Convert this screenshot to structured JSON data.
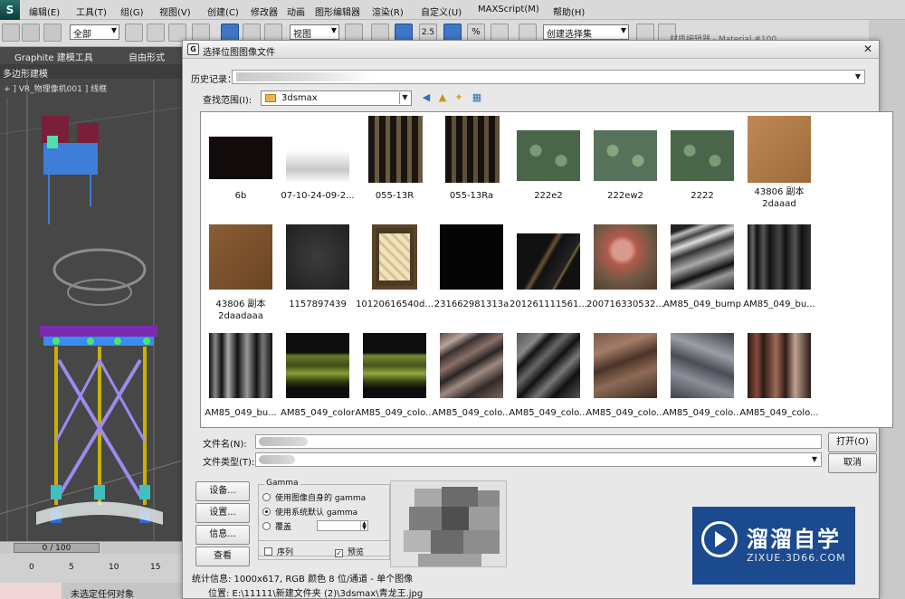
{
  "app": {
    "logo_text": "S",
    "menu": [
      "编辑(E)",
      "工具(T)",
      "组(G)",
      "视图(V)",
      "创建(C)",
      "修改器",
      "动画",
      "图形编辑器",
      "渲染(R)",
      "自定义(U)",
      "MAXScript(M)",
      "帮助(H)"
    ],
    "toolbar": {
      "filter_select": "全部",
      "view_select": "视图",
      "selection_set": "创建选择集",
      "snap_2_5": "2.5",
      "percent_snap": "%"
    },
    "ribbon": {
      "tabs": [
        "Graphite 建模工具",
        "自由形式"
      ],
      "subtab": "多边形建模"
    },
    "viewport_label": "+ ] VR_物理像机001 ] 线框",
    "timeline": "0 / 100",
    "ruler_ticks": [
      "0",
      "5",
      "10",
      "15"
    ],
    "status": "未选定任何对象",
    "material_editor_title": "材质编辑器 - Material #100"
  },
  "dialog": {
    "title": "选择位图图像文件",
    "history_label": "历史记录：",
    "lookin_label": "查找范围(I):",
    "lookin_value": "3dsmax",
    "filename_label": "文件名(N):",
    "filetype_label": "文件类型(T):",
    "open_button": "打开(O)",
    "cancel_button": "取消",
    "setup_button": "设备...",
    "settings_button": "设置...",
    "info_button": "信息...",
    "view_button": "查看",
    "gamma": {
      "title": "Gamma",
      "options": [
        "使用图像自身的 gamma",
        "使用系统默认 gamma",
        "覆盖"
      ],
      "selected_index": 1
    },
    "sequence_label": "序列",
    "preview_label": "预览",
    "sequence_checked": false,
    "preview_checked": true,
    "stats": "统计信息: 1000x617, RGB 颜色 8 位/通道 - 单个图像",
    "location": "位置: E:\\11111\\新建文件夹 (2)\\3dsmax\\青龙王.jpg",
    "files": [
      {
        "name": "6b",
        "thumb_color": "#120b0b"
      },
      {
        "name": "07-10-24-09-2...",
        "thumb_color": "#dcdcdc"
      },
      {
        "name": "055-13R",
        "thumb_color": "#3a2f22"
      },
      {
        "name": "055-13Ra",
        "thumb_color": "#2d271e"
      },
      {
        "name": "222e2",
        "thumb_color": "#4f6a4e"
      },
      {
        "name": "222ew2",
        "thumb_color": "#587556"
      },
      {
        "name": "2222",
        "thumb_color": "#4f6a4e"
      },
      {
        "name": "43806 副本\n2daaad",
        "thumb_color": "#b07a45"
      },
      {
        "name": "43806 副本\n2daadaaa",
        "thumb_color": "#7d5530"
      },
      {
        "name": "1157897439",
        "thumb_color": "#2e2e2e"
      },
      {
        "name": "10120616540d...",
        "thumb_color": "#d9c89a"
      },
      {
        "name": "231662981313a",
        "thumb_color": "#050505"
      },
      {
        "name": "201261111561...",
        "thumb_color": "#1a1815"
      },
      {
        "name": "200716330532...",
        "thumb_color": "#8b6a52"
      },
      {
        "name": "AM85_049_bump",
        "thumb_color": "#3b3b3b"
      },
      {
        "name": "AM85_049_bu...",
        "thumb_color": "#2b2b2b"
      },
      {
        "name": "AM85_049_bu...",
        "thumb_color": "#262626"
      },
      {
        "name": "AM85_049_color",
        "thumb_color": "#4d5a1e"
      },
      {
        "name": "AM85_049_colo...",
        "thumb_color": "#556322"
      },
      {
        "name": "AM85_049_colo...",
        "thumb_color": "#4a4440"
      },
      {
        "name": "AM85_049_colo...",
        "thumb_color": "#1f1f1f"
      },
      {
        "name": "AM85_049_colo...",
        "thumb_color": "#7a5a48"
      },
      {
        "name": "AM85_049_colo...",
        "thumb_color": "#4a4d55"
      },
      {
        "name": "AM85_049_colo...",
        "thumb_color": "#3b2a22"
      }
    ]
  },
  "watermark": {
    "title": "溜溜自学",
    "subtitle": "ZIXUE.3D66.COM"
  }
}
